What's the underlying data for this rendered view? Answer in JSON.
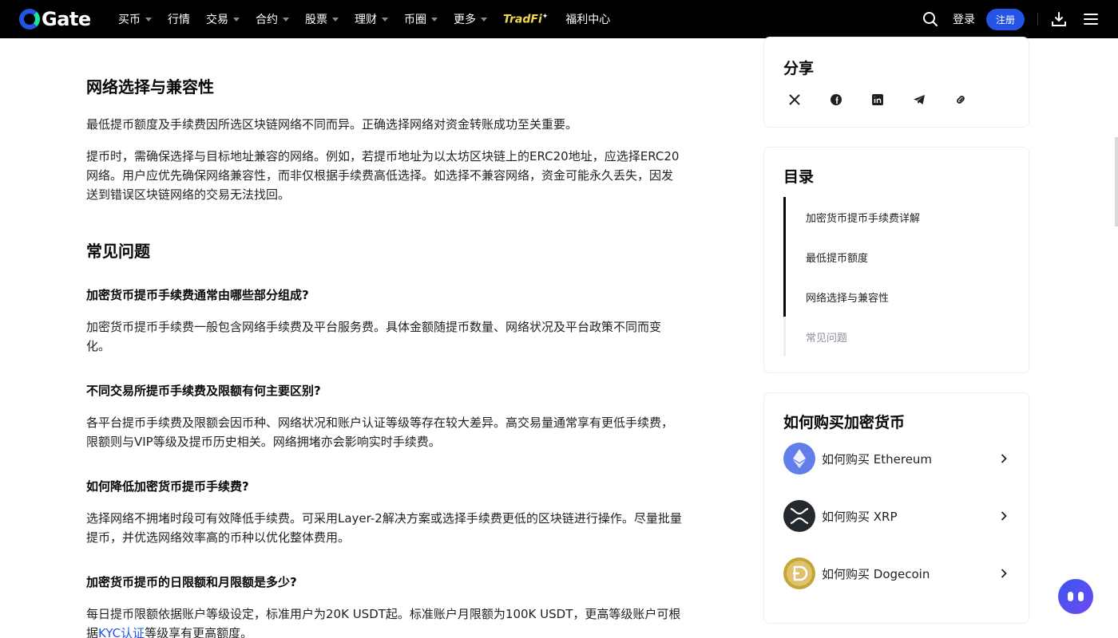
{
  "nav": {
    "logo_text": "Gate",
    "items": [
      {
        "label": "买币",
        "dropdown": true
      },
      {
        "label": "行情",
        "dropdown": false
      },
      {
        "label": "交易",
        "dropdown": true
      },
      {
        "label": "合约",
        "dropdown": true
      },
      {
        "label": "股票",
        "dropdown": true
      },
      {
        "label": "理财",
        "dropdown": true
      },
      {
        "label": "币圈",
        "dropdown": true
      },
      {
        "label": "更多",
        "dropdown": true
      }
    ],
    "tradfi_label": "TradFi",
    "welfare_label": "福利中心",
    "login_label": "登录",
    "register_label": "注册",
    "icons": [
      "search-icon",
      "download-icon",
      "menu-icon"
    ]
  },
  "article": {
    "section_network_title": "网络选择与兼容性",
    "section_network_p1": "最低提币额度及手续费因所选区块链网络不同而异。正确选择网络对资金转账成功至关重要。",
    "section_network_p2": "提币时，需确保选择与目标地址兼容的网络。例如，若提币地址为以太坊区块链上的ERC20地址，应选择ERC20网络。用户应优先确保网络兼容性，而非仅根据手续费高低选择。如选择不兼容网络，资金可能永久丢失，因发送到错误区块链网络的交易无法找回。",
    "faq_title": "常见问题",
    "faq": [
      {
        "q": "加密货币提币手续费通常由哪些部分组成?",
        "a": "加密货币提币手续费一般包含网络手续费及平台服务费。具体金额随提币数量、网络状况及平台政策不同而变化。"
      },
      {
        "q": "不同交易所提币手续费及限额有何主要区别?",
        "a": "各平台提币手续费及限额会因币种、网络状况和账户认证等级等存在较大差异。高交易量通常享有更低手续费，限额则与VIP等级及提币历史相关。网络拥堵亦会影响实时手续费。"
      },
      {
        "q": "如何降低加密货币提币手续费?",
        "a": "选择网络不拥堵时段可有效降低手续费。可采用Layer-2解决方案或选择手续费更低的区块链进行操作。尽量批量提币，并优选网络效率高的币种以优化整体费用。"
      },
      {
        "q": "加密货币提币的日限额和月限额是多少?",
        "a_before": "每日提币限额依据账户等级设定，标准用户为20K USDT起。标准账户月限额为100K USDT，更高等级账户可根据",
        "a_link": "KYC认证",
        "a_after": "等级享有更高额度。"
      }
    ]
  },
  "share": {
    "title": "分享",
    "icons": [
      "x-icon",
      "facebook-icon",
      "linkedin-icon",
      "telegram-icon",
      "link-icon"
    ]
  },
  "toc": {
    "title": "目录",
    "items": [
      {
        "label": "加密货币提币手续费详解",
        "active": true
      },
      {
        "label": "最低提币额度",
        "active": true
      },
      {
        "label": "网络选择与兼容性",
        "active": true
      },
      {
        "label": "常见问题",
        "active": false
      }
    ]
  },
  "buy": {
    "title": "如何购买加密货币",
    "items": [
      {
        "label": "如何购买 Ethereum",
        "icon": "ethereum-icon",
        "color": "#627eea"
      },
      {
        "label": "如何购买 XRP",
        "icon": "xrp-icon",
        "color": "#23292f"
      },
      {
        "label": "如何购买 Dogecoin",
        "icon": "dogecoin-icon",
        "color": "#c2a633"
      }
    ]
  },
  "colors": {
    "accent": "#2354e6",
    "nav_bg": "#000000",
    "tradfi": "#f0d94a"
  }
}
